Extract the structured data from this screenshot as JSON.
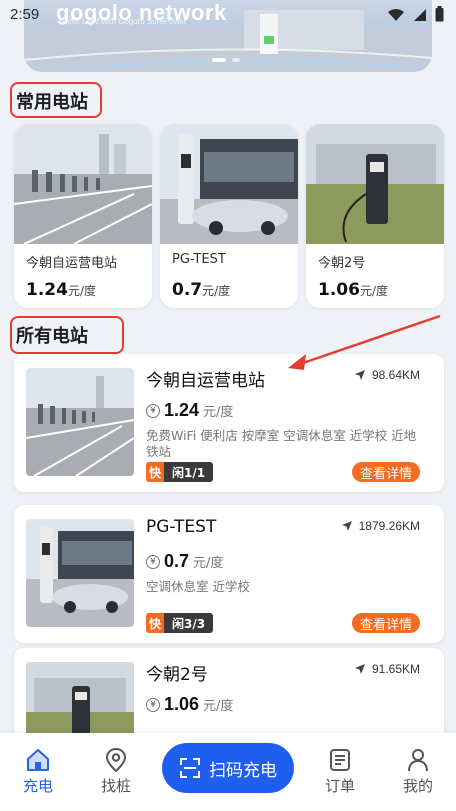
{
  "status_bar": {
    "time": "2:59"
  },
  "banner": {
    "title": "gogolo network",
    "subtitle": "Traffic Light with Gogoro SurePower"
  },
  "sections": {
    "frequent_title": "常用电站",
    "all_title": "所有电站"
  },
  "frequent_stations": [
    {
      "name": "今朝自运营电站",
      "price": "1.24",
      "unit": "元/度"
    },
    {
      "name": "PG-TEST",
      "price": "0.7",
      "unit": "元/度"
    },
    {
      "name": "今朝2号",
      "price": "1.06",
      "unit": "元/度"
    }
  ],
  "stations": [
    {
      "name": "今朝自运营电站",
      "distance": "98.64KM",
      "price": "1.24",
      "unit": "元/度",
      "tags": "免费WiFi 便利店 按摩室 空调休息室 近学校 近地铁站",
      "fast_label": "快",
      "idle": "闲1/1",
      "detail_label": "查看详情"
    },
    {
      "name": "PG-TEST",
      "distance": "1879.26KM",
      "price": "0.7",
      "unit": "元/度",
      "tags": "空调休息室 近学校",
      "fast_label": "快",
      "idle": "闲3/3",
      "detail_label": "查看详情"
    },
    {
      "name": "今朝2号",
      "distance": "91.65KM",
      "price": "1.06",
      "unit": "元/度",
      "tags": "",
      "fast_label": "",
      "idle": "",
      "detail_label": ""
    }
  ],
  "nav": {
    "items": [
      {
        "label": "充电",
        "icon": "home-icon"
      },
      {
        "label": "找桩",
        "icon": "location-pin-icon"
      },
      {
        "label": "订单",
        "icon": "order-list-icon"
      },
      {
        "label": "我的",
        "icon": "user-icon"
      }
    ],
    "scan_label": "扫码充电"
  },
  "colors": {
    "accent": "#f46b22",
    "primary": "#1f5ff0",
    "annotation": "#e63a32"
  }
}
